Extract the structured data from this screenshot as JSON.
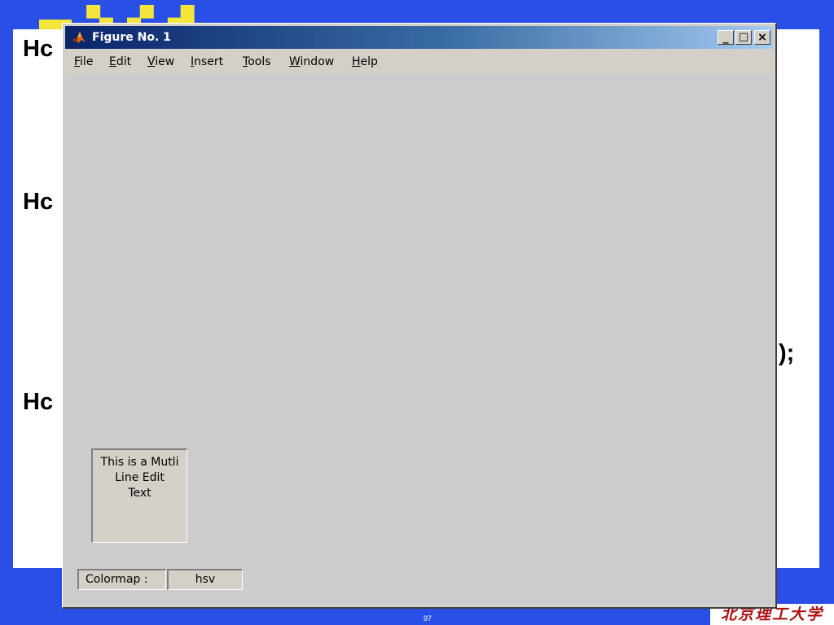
{
  "slide": {
    "hc_lines": [
      "Hc",
      "Hc",
      "Hc"
    ],
    "right_fragment": ");",
    "page_number": "97",
    "logo_text": "北京理工大学"
  },
  "window": {
    "title": "Figure No. 1",
    "buttons": {
      "minimize": "_",
      "maximize": "□",
      "close": "×"
    },
    "menu": [
      {
        "label": "File",
        "mnemonic": "F",
        "rest": "ile"
      },
      {
        "label": "Edit",
        "mnemonic": "E",
        "rest": "dit"
      },
      {
        "label": "View",
        "mnemonic": "V",
        "rest": "iew"
      },
      {
        "label": "Insert",
        "mnemonic": "I",
        "rest": "nsert"
      },
      {
        "label": "Tools",
        "mnemonic": "T",
        "rest": "ools"
      },
      {
        "label": "Window",
        "mnemonic": "W",
        "rest": "indow"
      },
      {
        "label": "Help",
        "mnemonic": "H",
        "rest": "elp"
      }
    ]
  },
  "figure": {
    "edit_text_lines": [
      "This is a Mutli",
      "Line Edit",
      "Text"
    ],
    "colormap_label": "Colormap :",
    "colormap_value": "hsv"
  },
  "colors": {
    "slide_background": "#2a4fe6",
    "title_yellow": "#f2e63a",
    "titlebar_start": "#0a246a",
    "titlebar_end": "#a6caf0",
    "window_face": "#d4d0c8",
    "figure_background": "#cccccc"
  }
}
